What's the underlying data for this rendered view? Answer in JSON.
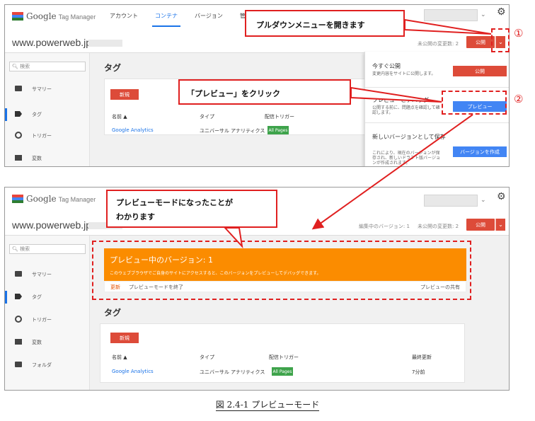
{
  "app": {
    "brand": "Google",
    "product": "Tag Manager",
    "domain": "www.powerweb.jp"
  },
  "shot1": {
    "nav": [
      "アカウント",
      "コンテナ",
      "バージョン",
      "管理"
    ],
    "active_nav_index": 1,
    "unpublished": "未公開の変更数: 2",
    "publish_label": "公開",
    "search_placeholder": "検索",
    "sidebar": [
      "サマリー",
      "タグ",
      "トリガー",
      "変数"
    ],
    "main_title": "タグ",
    "new_label": "新規",
    "columns": [
      "名前 ▲",
      "タイプ",
      "配信トリガー"
    ],
    "row": {
      "name": "Google Analytics",
      "type": "ユニバーサル アナリティクス",
      "trigger": "All Pages"
    },
    "dropdown": [
      {
        "title": "今すぐ公開",
        "desc": "変更内容をサイトに公開します。",
        "button": "公開"
      },
      {
        "title": "プレビューとデバッグ",
        "desc": "公開する前に、問題点を確認して確認します。",
        "button": "プレビュー"
      },
      {
        "title": "新しいバージョンとして保存",
        "desc": "これにより、現在のバージョンが保存され、新しいドラフト版バージョンが作成されます。",
        "button": "バージョンを作成"
      }
    ]
  },
  "shot2": {
    "editing_version": "編集中のバージョン: 1",
    "unpublished": "未公開の変更数: 2",
    "publish_label": "公開",
    "search_placeholder": "検索",
    "sidebar": [
      "サマリー",
      "タグ",
      "トリガー",
      "変数",
      "フォルダ"
    ],
    "preview_title": "プレビュー中のバージョン: 1",
    "preview_desc": "このウェブブラウザでご自身のサイトにアクセスすると、このバージョンをプレビューしてデバッグできます。",
    "refresh": "更新",
    "exit_preview": "プレビューモードを終了",
    "share_preview": "プレビューの共有",
    "main_title": "タグ",
    "new_label": "新規",
    "columns": [
      "名前 ▲",
      "タイプ",
      "配信トリガー",
      "最終更新"
    ],
    "row": {
      "name": "Google Analytics",
      "type": "ユニバーサル アナリティクス",
      "trigger": "All Pages",
      "updated": "7分前"
    }
  },
  "annotations": {
    "open_dropdown": "プルダウンメニューを開きます",
    "click_preview": "「プレビュー」をクリック",
    "preview_mode": [
      "プレビューモードになったことが",
      "わかります"
    ],
    "num1": "①",
    "num2": "②"
  },
  "caption": "図 2.4-1 プレビューモード",
  "colors": {
    "publish_red": "#dd4b39",
    "preview_blue": "#4285f4",
    "banner_orange": "#fb8c00",
    "annotation_red": "#e02020",
    "nav_active": "#1a73e8"
  }
}
